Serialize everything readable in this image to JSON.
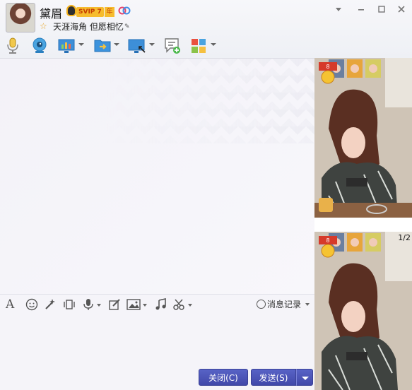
{
  "contact": {
    "name": "黛眉",
    "vip_level": "SVIP 7",
    "vip_year": "年",
    "signature": "天涯海角 但愿相忆"
  },
  "window_controls": [
    "dropdown",
    "minimize",
    "maximize",
    "close"
  ],
  "toolbar": {
    "items": [
      {
        "icon": "microphone-icon"
      },
      {
        "icon": "webcam-icon"
      },
      {
        "icon": "remote-desktop-icon",
        "has_menu": true
      },
      {
        "icon": "file-transfer-icon",
        "has_menu": true
      },
      {
        "icon": "screen-share-icon",
        "has_menu": true
      },
      {
        "icon": "new-discussion-icon"
      },
      {
        "icon": "apps-icon",
        "has_menu": true
      }
    ]
  },
  "input_toolbar": {
    "items": [
      "font-icon",
      "emoji-icon",
      "magic-icon",
      "shake-icon",
      "voice-icon",
      "edit-icon",
      "image-icon",
      "music-icon",
      "screenshot-icon"
    ],
    "history_label": "消息记录"
  },
  "buttons": {
    "close_label": "关闭(C)",
    "send_label": "发送(S)"
  },
  "show_panel": {
    "counter": "1/2"
  },
  "colors": {
    "button_blue": "#4a52b8",
    "window_bg": "#f5f4f9"
  }
}
